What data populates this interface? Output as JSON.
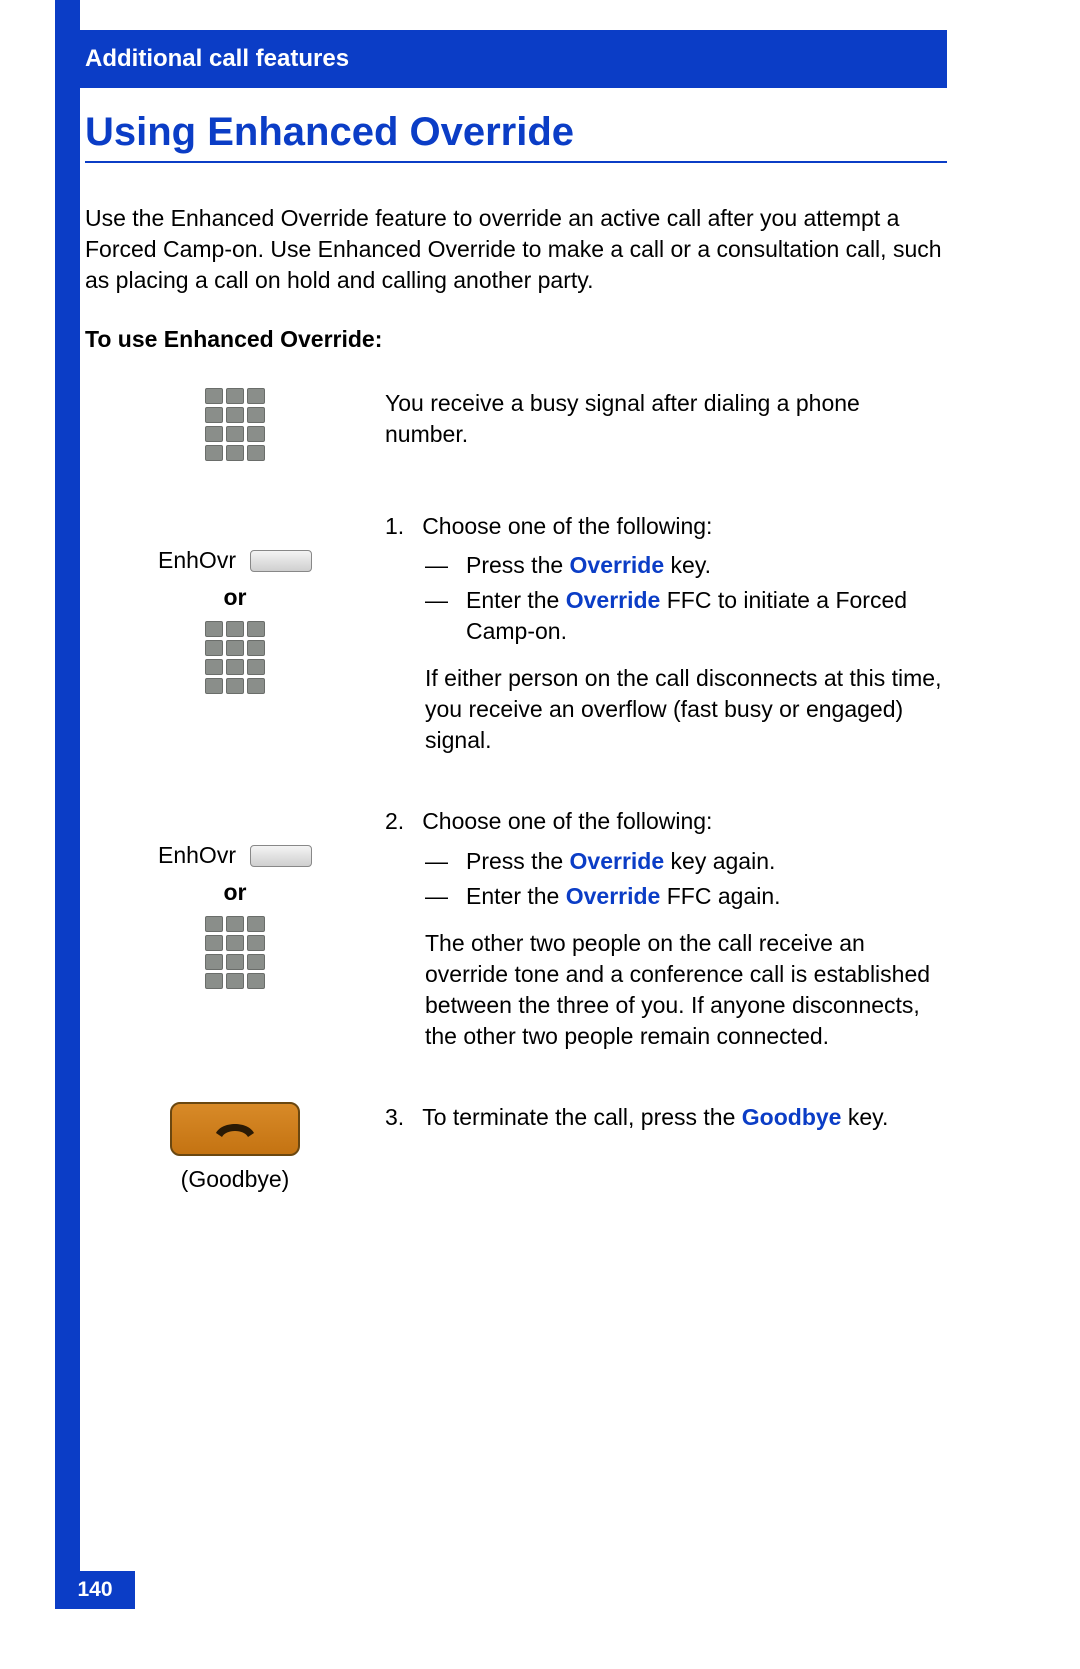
{
  "header": {
    "section": "Additional call features"
  },
  "title": "Using Enhanced Override",
  "intro": "Use the Enhanced Override feature to override an active call after you attempt a Forced Camp-on. Use Enhanced Override to make a call or a consultation call, such as placing a call on hold and calling another party.",
  "subhead": "To use Enhanced Override:",
  "labels": {
    "enhovr": "EnhOvr",
    "or": "or",
    "goodbye": "(Goodbye)"
  },
  "step0_text": "You receive a busy signal after dialing a phone number.",
  "step1": {
    "num": "1.",
    "lead": "Choose one of the following:",
    "b1_pre": "Press the ",
    "b1_key": "Override",
    "b1_post": " key.",
    "b2_pre": "Enter the ",
    "b2_key": "Override",
    "b2_post": " FFC to initiate a Forced Camp-on.",
    "para": "If either person on the call disconnects at this time, you receive an overflow (fast busy or engaged) signal."
  },
  "step2": {
    "num": "2.",
    "lead": "Choose one of the following:",
    "b1_pre": "Press the ",
    "b1_key": "Override",
    "b1_post": " key again.",
    "b2_pre": "Enter the ",
    "b2_key": "Override",
    "b2_post": " FFC again.",
    "para": "The other two people on the call receive an override tone and a conference call is established between the three of you. If anyone disconnects, the other two people remain connected."
  },
  "step3": {
    "num": "3.",
    "pre": "To terminate the call, press the ",
    "key": "Goodbye",
    "post": " key."
  },
  "page_number": "140"
}
